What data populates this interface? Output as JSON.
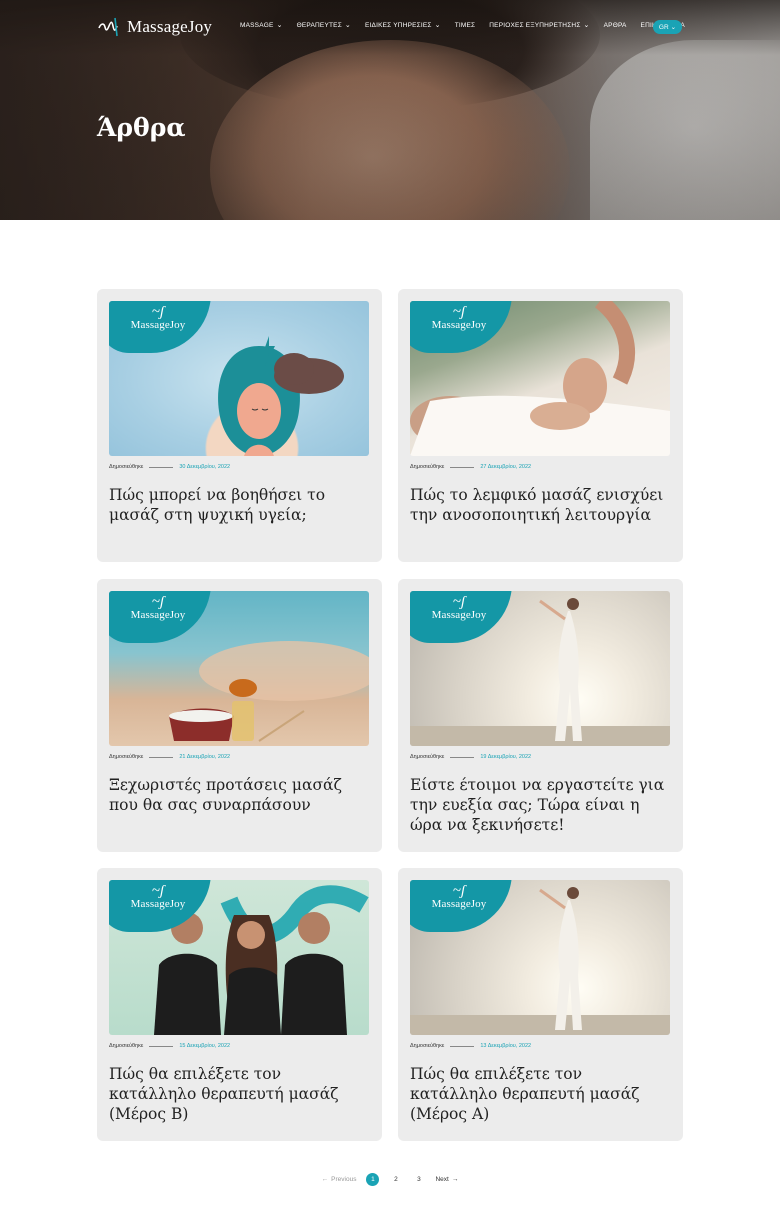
{
  "header": {
    "logo_text": "MassageJoy",
    "nav": [
      {
        "label": "MASSAGE",
        "dropdown": true
      },
      {
        "label": "ΘΕΡΑΠΕΥΤΕΣ",
        "dropdown": true
      },
      {
        "label": "ΕΙΔΙΚΕΣ ΥΠΗΡΕΣΙΕΣ",
        "dropdown": true
      },
      {
        "label": "ΤΙΜΕΣ",
        "dropdown": false
      },
      {
        "label": "ΠΕΡΙΟΧΕΣ ΕΞΥΠΗΡΕΤΗΣΗΣ",
        "dropdown": true
      },
      {
        "label": "ΑΡΘΡΑ",
        "dropdown": false
      },
      {
        "label": "ΕΠΙΚΟΙΝΩΝΙΑ",
        "dropdown": false
      }
    ],
    "language": "GR"
  },
  "hero": {
    "title": "Άρθρα"
  },
  "articles": [
    {
      "published_label": "Δημοσιεύθηκε",
      "date": "30 Δεκεμβρίου, 2022",
      "title": "Πώς μπορεί να βοηθήσει το μασάζ στη ψυχική υγεία;",
      "badge_text": "MassageJoy"
    },
    {
      "published_label": "Δημοσιεύθηκε",
      "date": "27 Δεκεμβρίου, 2022",
      "title": "Πώς το λεμφικό μασάζ ενισχύει την ανοσοποιητική λειτουργία",
      "badge_text": "MassageJoy"
    },
    {
      "published_label": "Δημοσιεύθηκε",
      "date": "21 Δεκεμβρίου, 2022",
      "title": "Ξεχωριστές προτάσεις μασάζ που θα σας συναρπάσουν",
      "badge_text": "MassageJoy"
    },
    {
      "published_label": "Δημοσιεύθηκε",
      "date": "19 Δεκεμβρίου, 2022",
      "title": "Είστε έτοιμοι να εργαστείτε για την ευεξία σας; Τώρα είναι η ώρα να ξεκινήσετε!",
      "badge_text": "MassageJoy"
    },
    {
      "published_label": "Δημοσιεύθηκε",
      "date": "15 Δεκεμβρίου, 2022",
      "title": "Πώς θα επιλέξετε τον κατάλληλο θεραπευτή μασάζ (Μέρος Β)",
      "badge_text": "MassageJoy"
    },
    {
      "published_label": "Δημοσιεύθηκε",
      "date": "13 Δεκεμβρίου, 2022",
      "title": "Πώς θα επιλέξετε τον κατάλληλο θεραπευτή μασάζ (Μέρος Α)",
      "badge_text": "MassageJoy"
    }
  ],
  "pagination": {
    "previous": "Previous",
    "pages": [
      "1",
      "2",
      "3"
    ],
    "current": "1",
    "next": "Next"
  },
  "colors": {
    "accent": "#1aa3b5",
    "card_bg": "#ececec"
  }
}
